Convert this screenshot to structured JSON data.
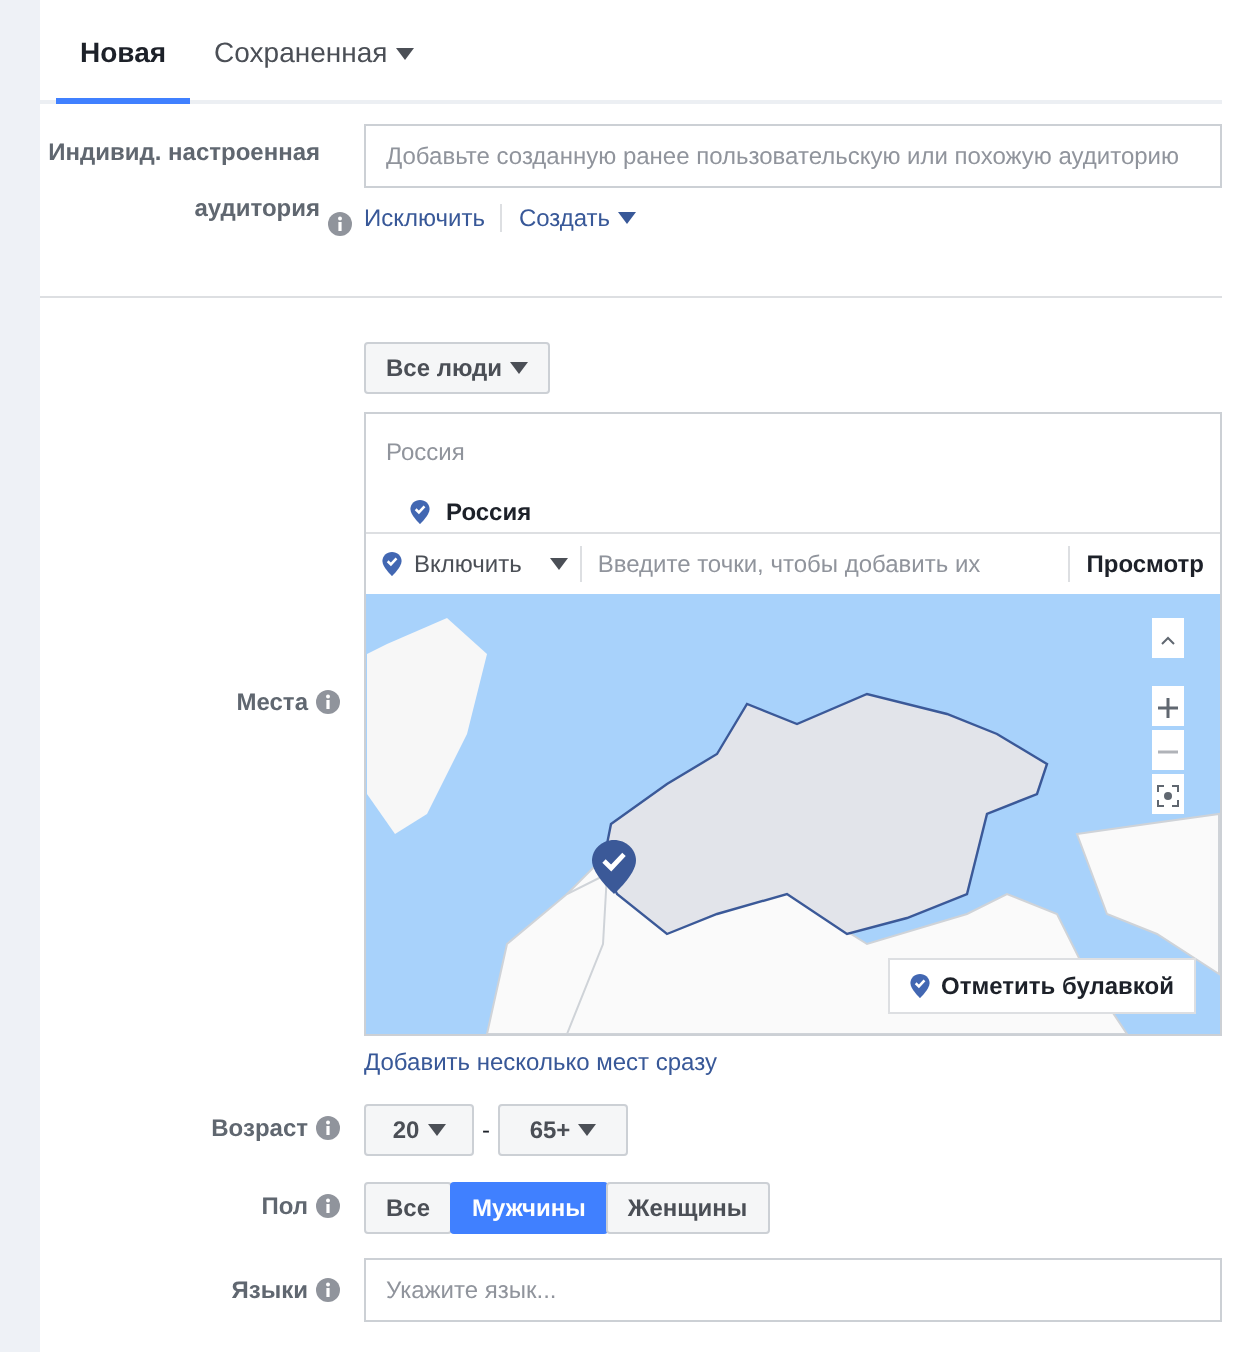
{
  "tabs": [
    {
      "label": "Новая",
      "selected": true,
      "dropdown": false
    },
    {
      "label": "Сохраненная",
      "selected": false,
      "dropdown": true
    }
  ],
  "custom_audience": {
    "label": "Индивид. настроенная аудитория",
    "placeholder": "Добавьте созданную ранее пользовательскую или похожую аудиторию",
    "links": [
      {
        "label": "Исключить",
        "dropdown": false
      },
      {
        "label": "Создать",
        "dropdown": true
      }
    ]
  },
  "locations": {
    "label": "Места",
    "audience_button": "Все люди",
    "search_header": "Россия",
    "selected_locations": [
      "Россия"
    ],
    "include_button": "Включить",
    "placeholder": "Введите точки, чтобы добавить их",
    "browse_button": "Просмотр",
    "drop_pin_button": "Отметить булавкой",
    "bulk_link": "Добавить несколько мест сразу"
  },
  "age": {
    "label": "Возраст",
    "min": "20",
    "separator": "-",
    "max": "65+"
  },
  "gender": {
    "label": "Пол",
    "options": [
      {
        "label": "Все",
        "selected": false
      },
      {
        "label": "Мужчины",
        "selected": true
      },
      {
        "label": "Женщины",
        "selected": false
      }
    ]
  },
  "languages": {
    "label": "Языки",
    "placeholder": "Укажите язык..."
  }
}
